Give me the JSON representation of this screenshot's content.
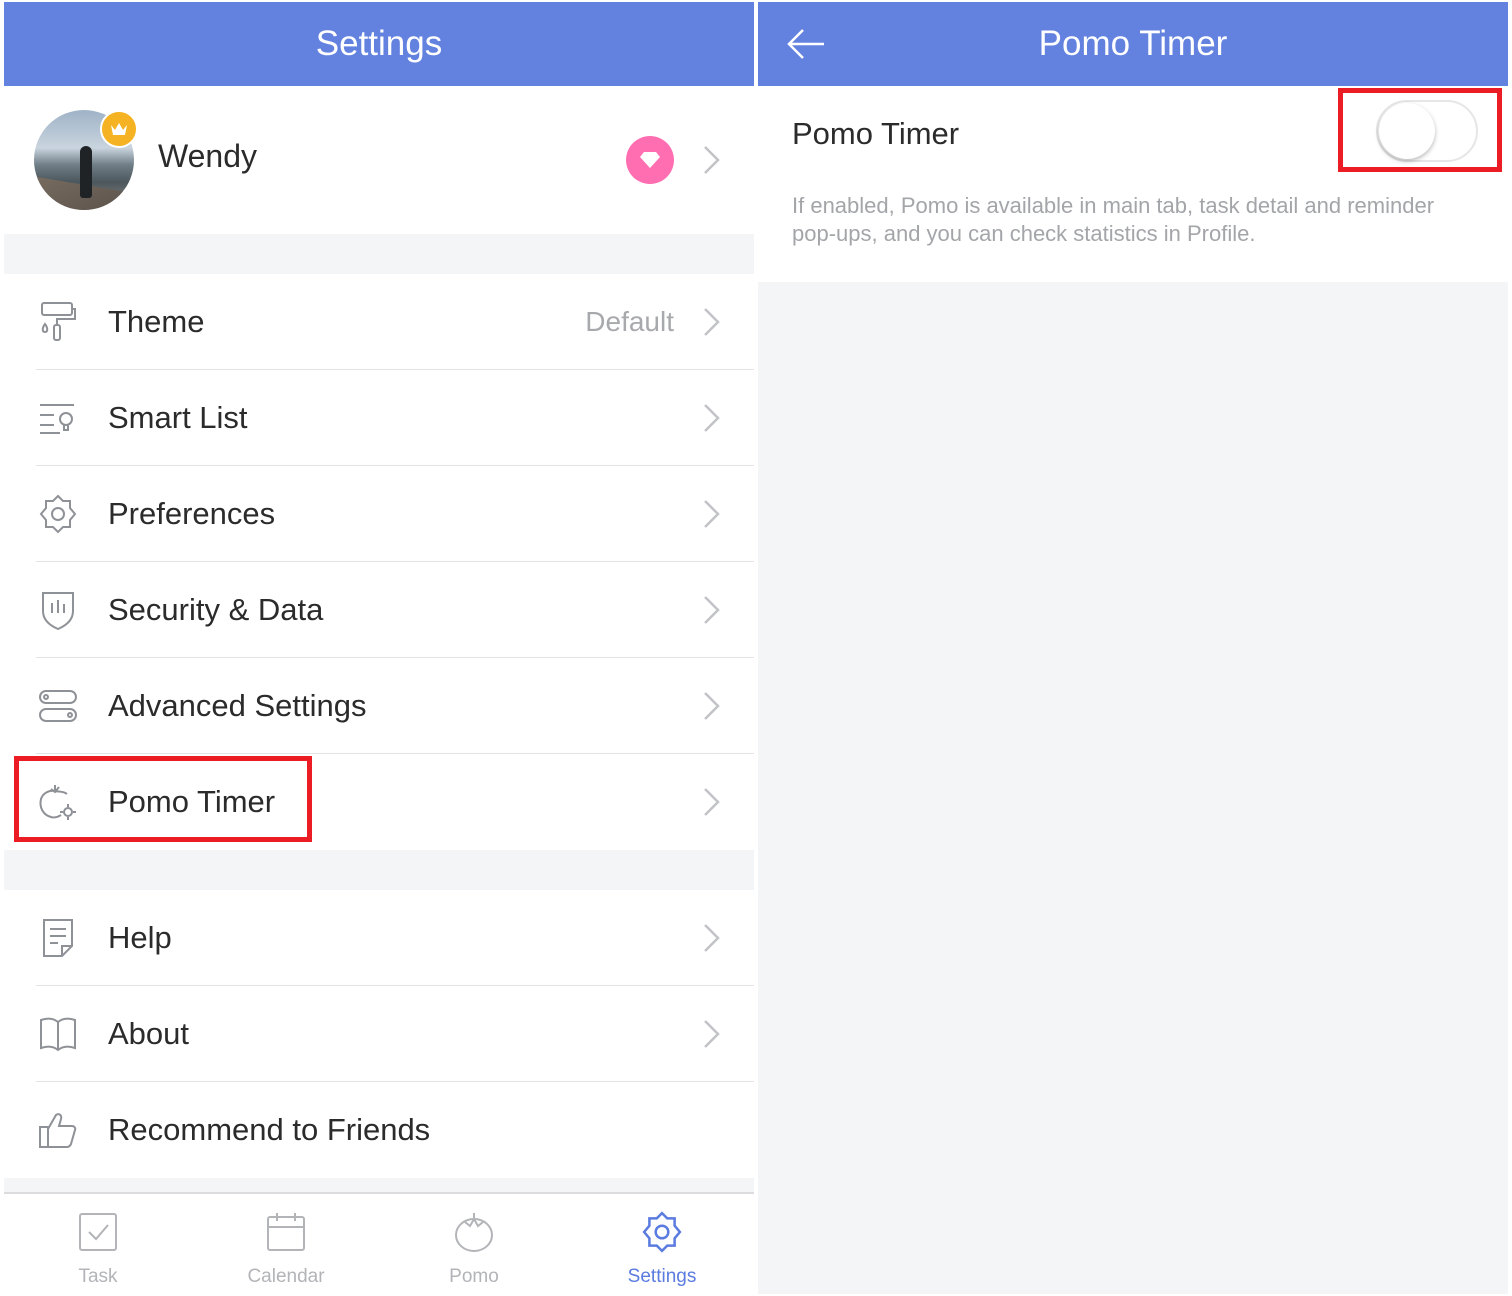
{
  "left": {
    "header": {
      "title": "Settings"
    },
    "profile": {
      "name": "Wendy"
    },
    "menu_group_1": [
      {
        "label": "Theme",
        "value": "Default",
        "icon": "paint-roller-icon"
      },
      {
        "label": "Smart List",
        "value": "",
        "icon": "smart-list-icon"
      },
      {
        "label": "Preferences",
        "value": "",
        "icon": "gear-icon"
      },
      {
        "label": "Security & Data",
        "value": "",
        "icon": "shield-icon"
      },
      {
        "label": "Advanced Settings",
        "value": "",
        "icon": "toggles-icon"
      },
      {
        "label": "Pomo Timer",
        "value": "",
        "icon": "tomato-gear-icon"
      }
    ],
    "menu_group_2": [
      {
        "label": "Help",
        "icon": "document-icon"
      },
      {
        "label": "About",
        "icon": "book-icon"
      },
      {
        "label": "Recommend to Friends",
        "icon": "thumbs-up-icon"
      }
    ],
    "tabs": [
      {
        "label": "Task",
        "icon": "checkbox-icon",
        "active": false
      },
      {
        "label": "Calendar",
        "icon": "calendar-icon",
        "active": false
      },
      {
        "label": "Pomo",
        "icon": "tomato-icon",
        "active": false
      },
      {
        "label": "Settings",
        "icon": "gear-icon",
        "active": true
      }
    ]
  },
  "right": {
    "header": {
      "title": "Pomo Timer"
    },
    "setting": {
      "title": "Pomo Timer",
      "enabled": false,
      "description": "If enabled, Pomo is available in main tab, task detail and reminder pop-ups, and you can check statistics in Profile."
    }
  },
  "colors": {
    "header": "#6382e0",
    "accent": "#5a7be0",
    "pro_badge": "#ff6eb1",
    "crown": "#f5b324",
    "highlight": "#ec1c24",
    "gap": "#f4f5f7"
  }
}
